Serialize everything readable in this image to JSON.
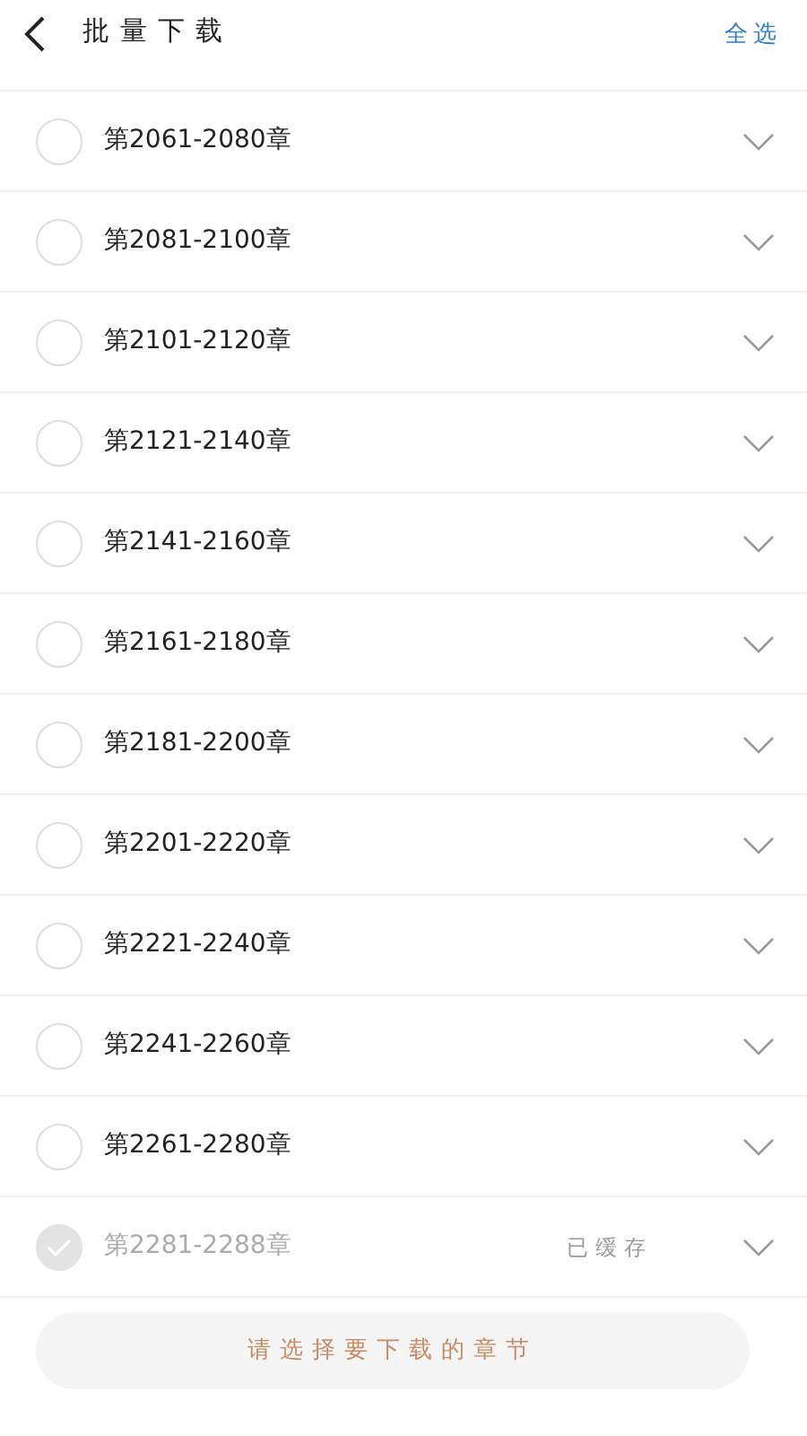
{
  "header": {
    "title": "批量下载",
    "select_all": "全选"
  },
  "chapters": [
    {
      "label": "第2061-2080章",
      "selected": false,
      "cached": false
    },
    {
      "label": "第2081-2100章",
      "selected": false,
      "cached": false
    },
    {
      "label": "第2101-2120章",
      "selected": false,
      "cached": false
    },
    {
      "label": "第2121-2140章",
      "selected": false,
      "cached": false
    },
    {
      "label": "第2141-2160章",
      "selected": false,
      "cached": false
    },
    {
      "label": "第2161-2180章",
      "selected": false,
      "cached": false
    },
    {
      "label": "第2181-2200章",
      "selected": false,
      "cached": false
    },
    {
      "label": "第2201-2220章",
      "selected": false,
      "cached": false
    },
    {
      "label": "第2221-2240章",
      "selected": false,
      "cached": false
    },
    {
      "label": "第2241-2260章",
      "selected": false,
      "cached": false
    },
    {
      "label": "第2261-2280章",
      "selected": false,
      "cached": false
    },
    {
      "label": "第2281-2288章",
      "selected": false,
      "cached": true,
      "status": "已缓存"
    }
  ],
  "download_button": {
    "label": "请选择要下载的章节",
    "disabled": true
  }
}
